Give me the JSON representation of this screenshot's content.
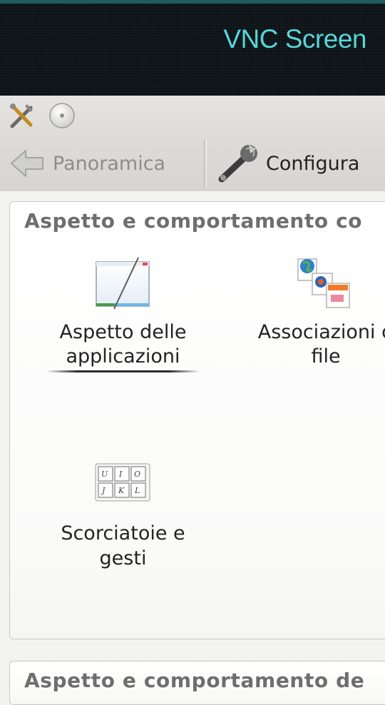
{
  "vnc": {
    "title": "VNC Screen"
  },
  "window": {
    "icons": [
      "tools-icon",
      "circle-button-icon"
    ]
  },
  "toolbar": {
    "overview_label": "Panoramica",
    "configure_label": "Configura"
  },
  "groups": [
    {
      "title": "Aspetto e comportamento co",
      "items": [
        {
          "line1": "Aspetto delle",
          "line2": "applicazioni",
          "icon": "application-appearance-icon"
        },
        {
          "line1": "Associazioni d",
          "line2": "file",
          "icon": "file-associations-icon"
        },
        {
          "line1": "Scorciatoie e",
          "line2": "gesti",
          "icon": "keyboard-shortcuts-icon"
        }
      ]
    },
    {
      "title": "Aspetto e comportamento de"
    }
  ]
}
